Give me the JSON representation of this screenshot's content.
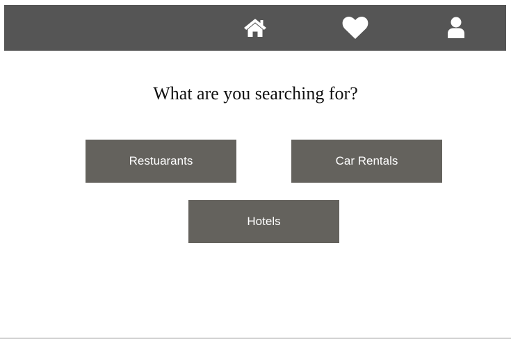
{
  "nav": {
    "items": [
      {
        "icon": "home-icon"
      },
      {
        "icon": "heart-icon"
      },
      {
        "icon": "user-icon"
      }
    ],
    "background_color": "#555555",
    "icon_color": "#ffffff"
  },
  "main": {
    "heading": "What are you searching for?",
    "categories": [
      {
        "label": "Restuarants"
      },
      {
        "label": "Car Rentals"
      },
      {
        "label": "Hotels"
      }
    ],
    "button_color": "#64625d"
  }
}
